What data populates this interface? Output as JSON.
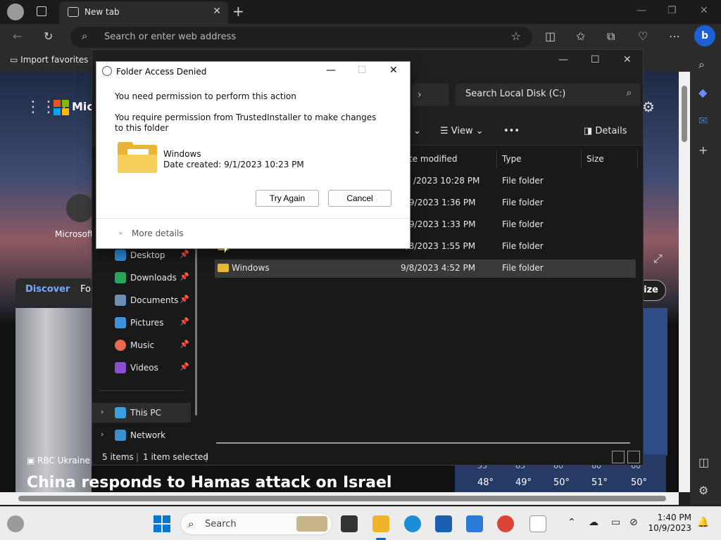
{
  "browser": {
    "tab_title": "New tab",
    "address_placeholder": "Search or enter web address",
    "favorites_import": "Import favorites"
  },
  "msn": {
    "brand": "Micr",
    "copilot_label": "Microsoft",
    "nav_discover": "Discover",
    "nav_next": "Fo",
    "personalize": "lize",
    "news_source": "RBC Ukraine",
    "headline": "China responds to Hamas attack on Israel",
    "weather_top": [
      "55",
      "65",
      "60",
      "60",
      "60"
    ],
    "weather_temps": [
      "48°",
      "49°",
      "50°",
      "51°",
      "50°"
    ]
  },
  "explorer": {
    "search_placeholder": "Search Local Disk (C:)",
    "cmd_view": "View",
    "cmd_more": "•••",
    "cmd_details": "Details",
    "columns": [
      "te modified",
      "Type",
      "Size"
    ],
    "rows": [
      {
        "name": "",
        "date": "/2023 10:28 PM",
        "type": "File folder"
      },
      {
        "name": "",
        "date": "/9/2023 1:36 PM",
        "type": "File folder"
      },
      {
        "name": "",
        "date": "/9/2023 1:33 PM",
        "type": "File folder"
      },
      {
        "name": "Users",
        "date": "9/8/2023 1:55 PM",
        "type": "File folder"
      },
      {
        "name": "Windows",
        "date": "9/8/2023 4:52 PM",
        "type": "File folder"
      }
    ],
    "nav": [
      {
        "label": "Desktop",
        "color": "#2b8cd8"
      },
      {
        "label": "Downloads",
        "color": "#27a55a"
      },
      {
        "label": "Documents",
        "color": "#6c8fb8"
      },
      {
        "label": "Pictures",
        "color": "#3b93d9"
      },
      {
        "label": "Music",
        "color": "#e46b4d"
      },
      {
        "label": "Videos",
        "color": "#8a4fd1"
      }
    ],
    "this_pc": "This PC",
    "network": "Network",
    "status_items": "5 items",
    "status_selected": "1 item selected"
  },
  "dialog": {
    "title": "Folder Access Denied",
    "line1": "You need permission to perform this action",
    "line2": "You require permission from TrustedInstaller to make changes to this folder",
    "folder_name": "Windows",
    "folder_date": "Date created: 9/1/2023 10:23 PM",
    "try_again": "Try Again",
    "cancel": "Cancel",
    "more_details": "More details"
  },
  "taskbar": {
    "search_placeholder": "Search",
    "time": "1:40 PM",
    "date": "10/9/2023"
  }
}
